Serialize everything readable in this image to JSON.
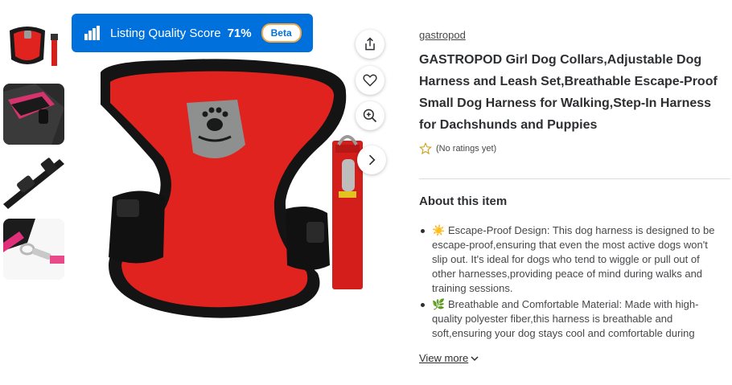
{
  "quality_banner": {
    "label": "Listing Quality Score",
    "score": "71%",
    "badge": "Beta",
    "icon": "bar-chart-icon"
  },
  "gallery": {
    "thumbnails": [
      {
        "alt": "red harness and leash thumbnail"
      },
      {
        "alt": "pink harness on dog thumbnail"
      },
      {
        "alt": "black buckle close-up thumbnail"
      },
      {
        "alt": "leash clip close-up thumbnail"
      }
    ],
    "actions": {
      "share_icon": "share-icon",
      "favorite_icon": "heart-icon",
      "zoom_icon": "zoom-in-icon",
      "next_icon": "chevron-right-icon"
    }
  },
  "product": {
    "brand": "gastropod",
    "title": "GASTROPOD Girl Dog Collars,Adjustable Dog Harness and Leash Set,Breathable Escape-Proof Small Dog Harness for Walking,Step-In Harness for Dachshunds and Puppies",
    "rating_text": "(No ratings yet)"
  },
  "about": {
    "heading": "About this item",
    "bullets": [
      {
        "emoji": "☀️",
        "text": "Escape-Proof Design: This dog harness is designed to be escape-proof,ensuring that even the most active dogs won't slip out. It's ideal for dogs who tend to wiggle or pull out of other harnesses,providing peace of mind during walks and training sessions."
      },
      {
        "emoji": "🌿",
        "text": "Breathable and Comfortable Material: Made with high-quality polyester fiber,this harness is breathable and soft,ensuring your dog stays cool and comfortable during lon..."
      }
    ],
    "view_more": "View more"
  },
  "colors": {
    "accent": "#0071dc",
    "harness_red": "#e0231f",
    "harness_black": "#1a1a1a"
  }
}
